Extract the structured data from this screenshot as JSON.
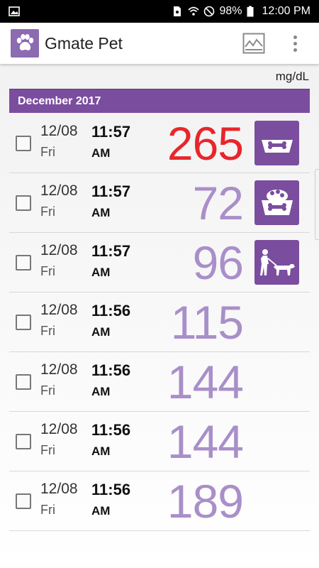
{
  "status": {
    "battery": "98%",
    "time": "12:00 PM"
  },
  "app": {
    "title": "Gmate Pet"
  },
  "unit": "mg/dL",
  "month": "December 2017",
  "rows": [
    {
      "date": "12/08",
      "dow": "Fri",
      "time": "11:57",
      "ampm": "AM",
      "value": "265",
      "tag": "bowl-bone-icon",
      "color": "#e8262b"
    },
    {
      "date": "12/08",
      "dow": "Fri",
      "time": "11:57",
      "ampm": "AM",
      "value": "72",
      "tag": "full-bowl-bone-icon",
      "color": "#a98fc9"
    },
    {
      "date": "12/08",
      "dow": "Fri",
      "time": "11:57",
      "ampm": "AM",
      "value": "96",
      "tag": "dog-walk-icon",
      "color": "#a98fc9"
    },
    {
      "date": "12/08",
      "dow": "Fri",
      "time": "11:56",
      "ampm": "AM",
      "value": "115",
      "tag": "",
      "color": "#a98fc9"
    },
    {
      "date": "12/08",
      "dow": "Fri",
      "time": "11:56",
      "ampm": "AM",
      "value": "144",
      "tag": "",
      "color": "#a98fc9"
    },
    {
      "date": "12/08",
      "dow": "Fri",
      "time": "11:56",
      "ampm": "AM",
      "value": "144",
      "tag": "",
      "color": "#a98fc9"
    },
    {
      "date": "12/08",
      "dow": "Fri",
      "time": "11:56",
      "ampm": "AM",
      "value": "189",
      "tag": "",
      "color": "#a98fc9"
    }
  ],
  "colors": {
    "accent": "#7b4d9e",
    "high": "#e8262b",
    "normal": "#a98fc9"
  }
}
